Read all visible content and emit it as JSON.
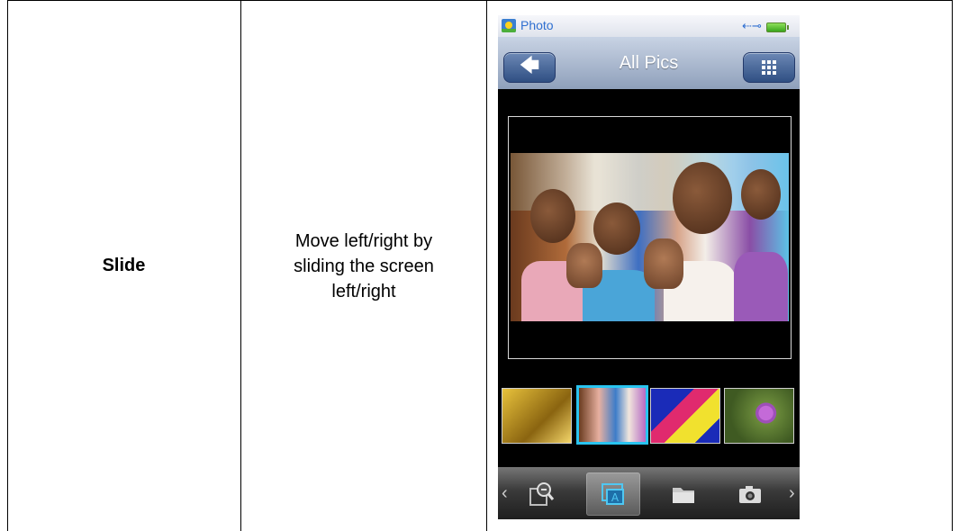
{
  "table": {
    "gesture": "Slide",
    "description_lines": [
      "Move left/right by",
      "sliding the screen",
      "left/right"
    ]
  },
  "phone": {
    "status": {
      "app_label": "Photo",
      "app_icon": "photo-app-icon",
      "usb_icon": "usb-icon",
      "battery_icon": "battery-icon"
    },
    "title_bar": {
      "title": "All Pics",
      "back_icon": "back-arrow-icon",
      "grid_icon": "grid-view-icon"
    },
    "thumbnails": [
      {
        "name": "thumb-golden",
        "selected": false
      },
      {
        "name": "thumb-children",
        "selected": true
      },
      {
        "name": "thumb-parrot",
        "selected": false
      },
      {
        "name": "thumb-flower",
        "selected": false
      }
    ],
    "toolbar": {
      "items": [
        {
          "icon": "zoom-icon",
          "active": false
        },
        {
          "icon": "slideshow-icon",
          "active": true
        },
        {
          "icon": "folder-icon",
          "active": false
        },
        {
          "icon": "camera-icon",
          "active": false
        }
      ],
      "left_arrow": "chevron-left-icon",
      "right_arrow": "chevron-right-icon"
    },
    "colors": {
      "selection": "#29c4f0",
      "title_button": "#2f4f83",
      "status_text": "#2f6fd0"
    }
  }
}
